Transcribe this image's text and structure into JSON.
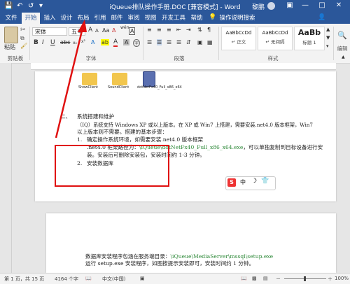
{
  "window": {
    "title": "iQueue排队操作手册.DOC [兼容模式] - Word",
    "user": "黎鹏"
  },
  "quick_access": {
    "save_icon": "save-icon",
    "undo_icon": "undo-icon",
    "redo_icon": "redo-icon"
  },
  "tabs": [
    "文件",
    "开始",
    "插入",
    "设计",
    "布局",
    "引用",
    "邮件",
    "审阅",
    "视图",
    "开发工具",
    "帮助",
    "操作说明搜索"
  ],
  "ribbon": {
    "paste_label": "粘贴",
    "clipboard_label": "剪贴板",
    "font_name": "宋体",
    "font_size": "五号",
    "font_group_label": "字体",
    "paragraph_group_label": "段落",
    "styles_group_label": "样式",
    "editing_label": "编辑",
    "styles": [
      {
        "preview": "AaBbCcDd",
        "name": "↵ 正文"
      },
      {
        "preview": "AaBbCcDd",
        "name": "↵ 无间隔"
      },
      {
        "preview": "AaBb",
        "name": "标题 1"
      }
    ],
    "bold": "B",
    "italic": "I",
    "underline": "U",
    "font_color": "A",
    "highlight": "ab",
    "font_grow": "A",
    "font_shrink": "A",
    "case": "Aa",
    "font_a": "A",
    "char_border": "A",
    "phonetic": "wén"
  },
  "page1": {
    "icons": [
      {
        "label": "ShowClient"
      },
      {
        "label": "SoundClient"
      },
      {
        "label": "dotNetFx40_Full_x86_x64"
      }
    ],
    "section_num": "二、",
    "section_title": "系统搭建和维护",
    "p1_line1": "（IQ）系统支持 Windows XP 或以上版本。在 XP 或 Win7 上搭建，需要安装.net4.0 版本框架，Win7",
    "p1_line2": "以上版本则不需要。搭建的基本步骤：",
    "step1_num": "1.",
    "step1_text": "确定操作系统环境，如需要安装.net4.0 版本框架",
    "step1_l2a": ".net4.0 框架路径为：",
    "step1_l2path": "\\iQueue\\dotNetFx40_Full_x86_x64.exe",
    "step1_l2b": "，可以单独复制到目标设备进行安",
    "step1_l3": "装。安装后可删除安装包，安装时间约 1-3 分钟。",
    "step2_num": "2.",
    "step2_text": "安装数据库"
  },
  "ime": [
    "S",
    "中",
    "☽",
    "👕"
  ],
  "page2": {
    "line1a": "数据库安装程序包涵在服务端目录：",
    "line1path": "\\iQueue\\MediaServer\\mssql\\setup.exe",
    "line2": "运行 setup.exe 安装程序，如图按提示安装即可，安装时间约 1 分钟。"
  },
  "status": {
    "page": "第 1 页，共 15 页",
    "words": "4164 个字",
    "lang": "中文(中国)",
    "zoom": "100%",
    "zoom_minus": "－",
    "zoom_plus": "＋"
  },
  "colors": {
    "accent": "#2b579a",
    "annotation": "#e01010",
    "path": "#2f8a3a"
  }
}
